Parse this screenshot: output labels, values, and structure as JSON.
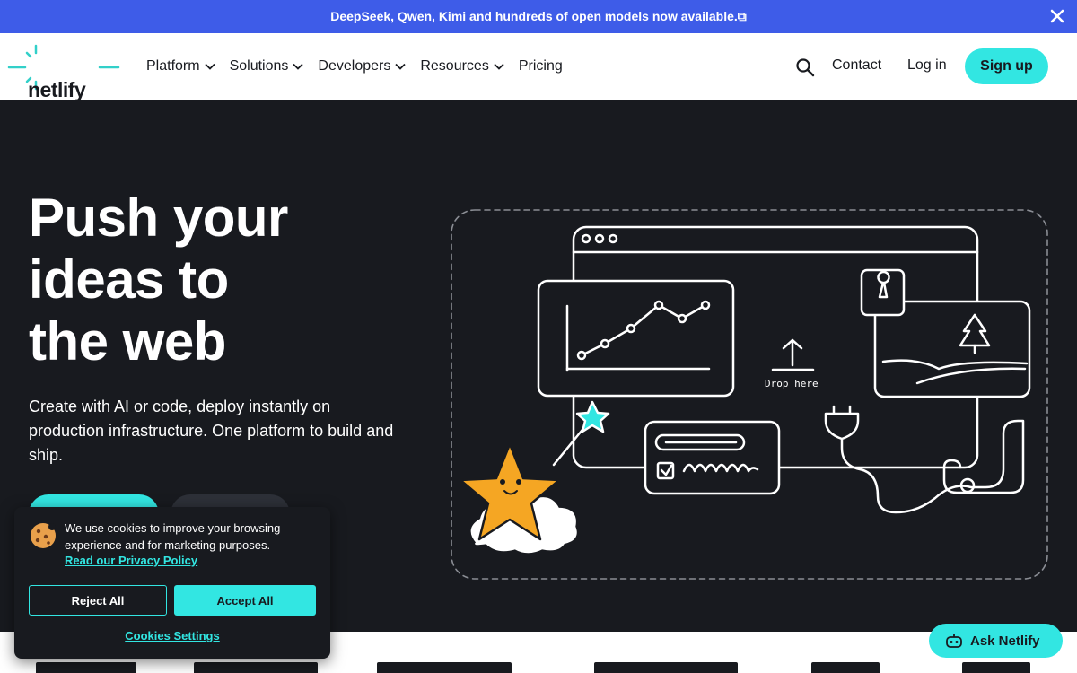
{
  "announcement": {
    "text": "DeepSeek, Qwen, Kimi and hundreds of open models now available.⧉"
  },
  "header": {
    "logo_text": "netlify",
    "nav": [
      {
        "label": "Platform",
        "has_menu": true
      },
      {
        "label": "Solutions",
        "has_menu": true
      },
      {
        "label": "Developers",
        "has_menu": true
      },
      {
        "label": "Resources",
        "has_menu": true
      },
      {
        "label": "Pricing",
        "has_menu": false
      }
    ],
    "contact_label": "Contact",
    "login_label": "Log in",
    "signup_label": "Sign up"
  },
  "hero": {
    "title_lines": [
      "Push your",
      "ideas to",
      "the web"
    ],
    "subtitle": "Create with AI or code, deploy instantly on production infrastructure. One platform to build and ship.",
    "illustration_drop_label": "Drop here"
  },
  "cookie": {
    "text": "We use cookies to improve your browsing experience and for marketing purposes.",
    "link": "Read our Privacy Policy",
    "reject_label": "Reject All",
    "accept_label": "Accept All",
    "settings_label": "Cookies Settings"
  },
  "ask": {
    "label": "Ask Netlify"
  },
  "colors": {
    "accent": "#32e6e2",
    "announce": "#3e5ce8",
    "dark": "#181a1f"
  }
}
